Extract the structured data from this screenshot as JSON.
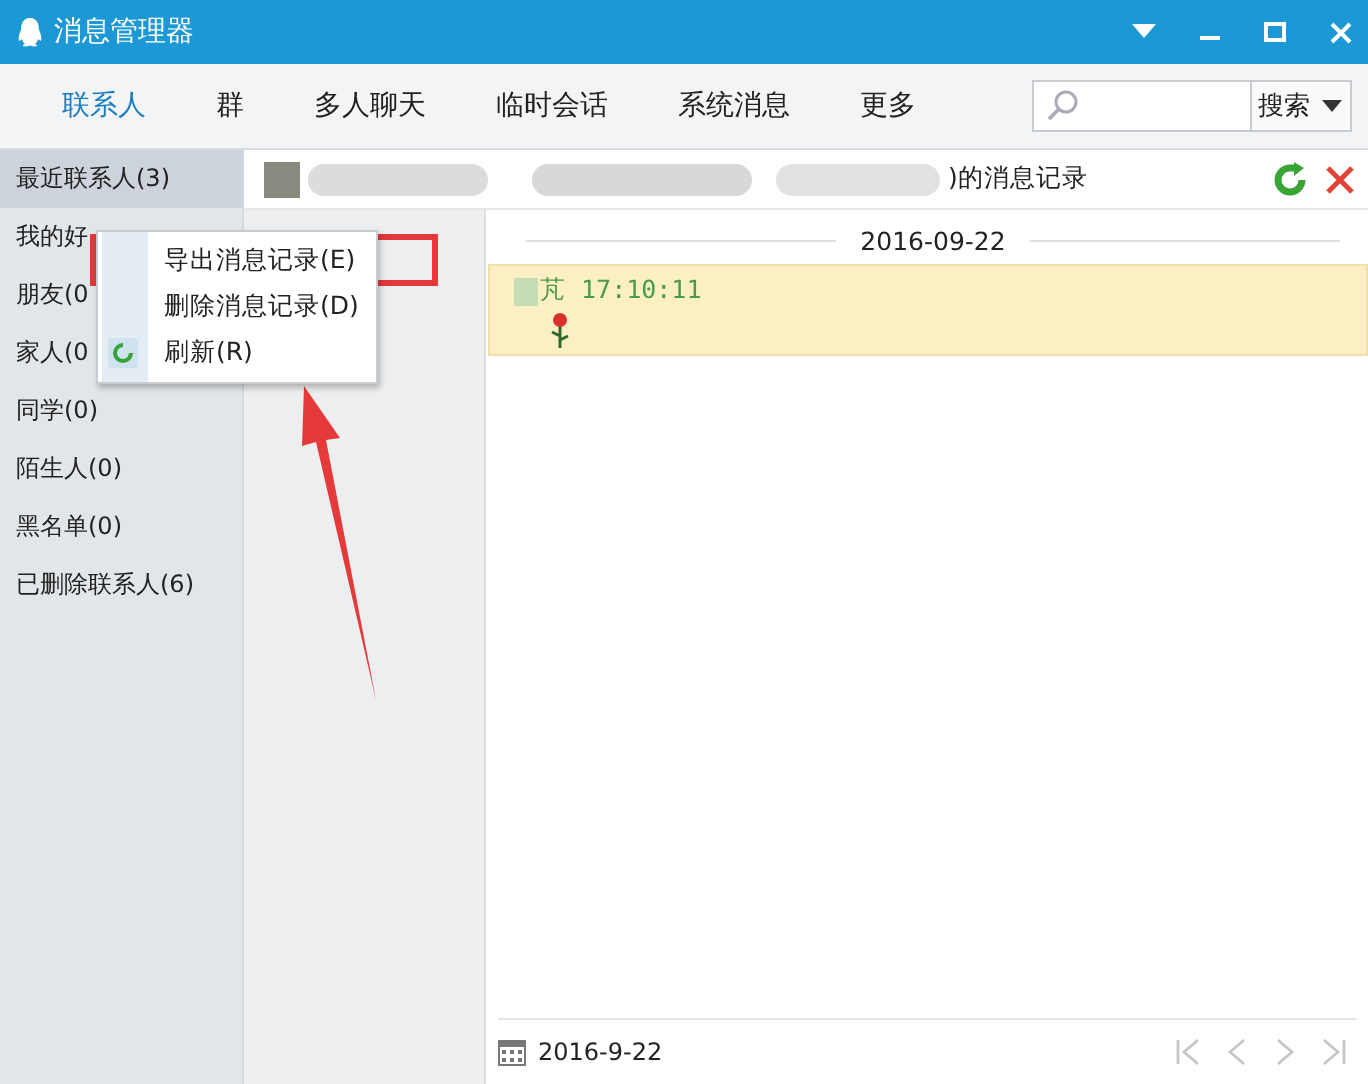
{
  "window": {
    "title": "消息管理器"
  },
  "tabs": [
    {
      "label": "联系人",
      "selected": true
    },
    {
      "label": "群",
      "selected": false
    },
    {
      "label": "多人聊天",
      "selected": false
    },
    {
      "label": "临时会话",
      "selected": false
    },
    {
      "label": "系统消息",
      "selected": false
    },
    {
      "label": "更多",
      "selected": false
    }
  ],
  "search": {
    "button": "搜索"
  },
  "sidebar": {
    "items": [
      {
        "label": "最近联系人(3)",
        "selected": true
      },
      {
        "label": "我的好",
        "selected": false
      },
      {
        "label": "朋友(0",
        "selected": false
      },
      {
        "label": "家人(0",
        "selected": false
      },
      {
        "label": "同学(0)",
        "selected": false
      },
      {
        "label": "陌生人(0)",
        "selected": false
      },
      {
        "label": "黑名单(0)",
        "selected": false
      },
      {
        "label": "已删除联系人(6)",
        "selected": false
      }
    ]
  },
  "history": {
    "title_suffix": ")的消息记录",
    "date_divider": "2016-09-22",
    "messages": [
      {
        "header": "芃 17:10:11"
      }
    ],
    "footer_date": "2016-9-22",
    "pager_disabled": true
  },
  "context_menu": {
    "items": [
      {
        "label": "导出消息记录(E)",
        "kind": "plain"
      },
      {
        "label": "删除消息记录(D)",
        "kind": "plain"
      },
      {
        "label": "刷新(R)",
        "kind": "refresh"
      }
    ]
  }
}
